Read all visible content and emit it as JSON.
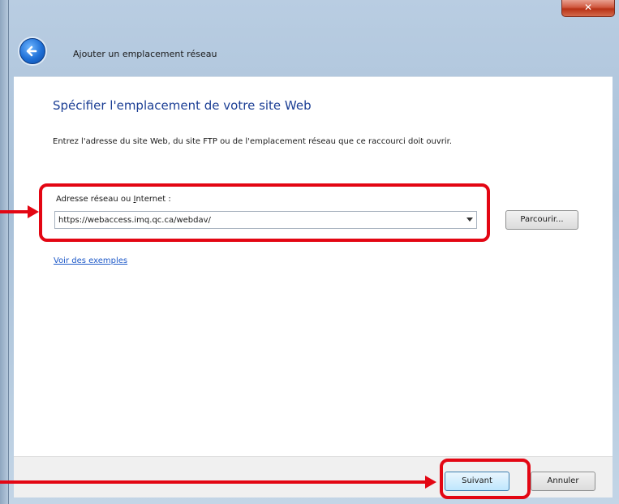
{
  "window": {
    "title": "Ajouter un emplacement réseau",
    "close_glyph": "✕"
  },
  "page": {
    "heading": "Spécifier l'emplacement de votre site Web",
    "description": "Entrez l'adresse du site Web, du site FTP ou de l'emplacement réseau que ce raccourci doit ouvrir.",
    "field_label_before": "Adresse réseau ou ",
    "field_label_underlined": "I",
    "field_label_after": "nternet :",
    "address_value": "https://webaccess.imq.qc.ca/webdav/",
    "browse_label": "Parcourir...",
    "examples_link": "Voir des exemples"
  },
  "footer": {
    "next_label": "Suivant",
    "cancel_label": "Annuler"
  },
  "icons": {
    "back": "back-arrow-icon",
    "dropdown": "chevron-down-icon",
    "close": "close-icon"
  },
  "annotation": {
    "color": "#e30613"
  }
}
